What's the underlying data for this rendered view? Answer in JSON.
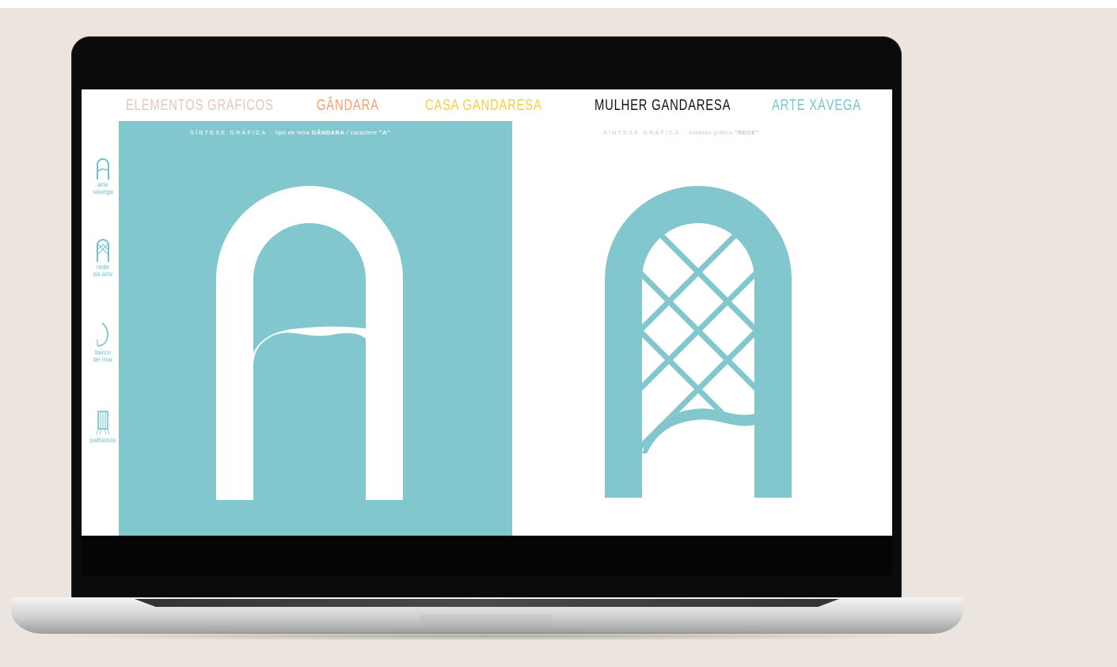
{
  "colors": {
    "teal": "#82c7cd",
    "nav_elementos": "#e7c6b7",
    "nav_gandara": "#f4a070",
    "nav_casa": "#f6cf3f",
    "nav_mulher": "#111111",
    "nav_arte": "#72c6cf"
  },
  "nav": [
    {
      "label": "ELEMENTOS GRÁFICOS"
    },
    {
      "label": "GÂNDARA"
    },
    {
      "label": "CASA GANDARESA"
    },
    {
      "label": "MULHER GANDARESA"
    },
    {
      "label": "ARTE XÁVEGA"
    }
  ],
  "sidebar": [
    {
      "icon": "letter-a-icon",
      "label_line1": "arte",
      "label_line2": "xávega"
    },
    {
      "icon": "net-arch-icon",
      "label_line1": "rede",
      "label_line2": "da arte"
    },
    {
      "icon": "boat-icon",
      "label_line1": "barco",
      "label_line2": "de mar"
    },
    {
      "icon": "palheiro-icon",
      "label_line1": "palheiros",
      "label_line2": ""
    }
  ],
  "panels": {
    "left": {
      "caption_prefix": "SÍNTESE GRÁFICA -",
      "caption_detail": " tipo de letra ",
      "caption_bold": "GÂNDARA",
      "caption_mid": " / caractere ",
      "caption_bold2": "\"A\""
    },
    "right": {
      "caption_prefix": "SÍNTESE GRÁFICA -",
      "caption_detail": " símbolo gráfico ",
      "caption_bold": "\"REDE\""
    }
  }
}
